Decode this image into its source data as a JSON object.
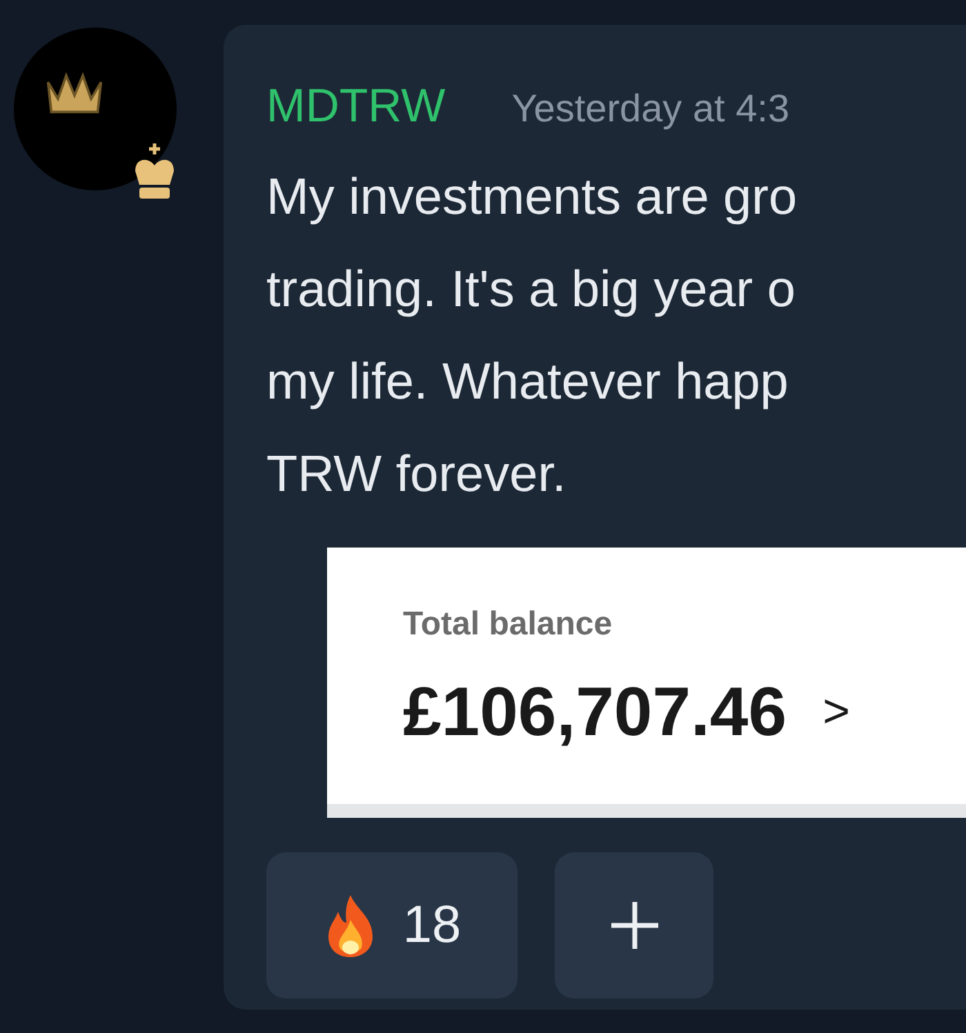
{
  "message": {
    "author": "MDTRW",
    "timestamp": "Yesterday at 4:3",
    "lines": [
      "My investments are gro",
      "trading. It's a big year o",
      "my life. Whatever happ",
      "TRW forever."
    ],
    "attachment": {
      "label": "Total balance",
      "amount": "£106,707.46",
      "chevron": ">"
    },
    "reactions": [
      {
        "count": "18"
      }
    ]
  }
}
